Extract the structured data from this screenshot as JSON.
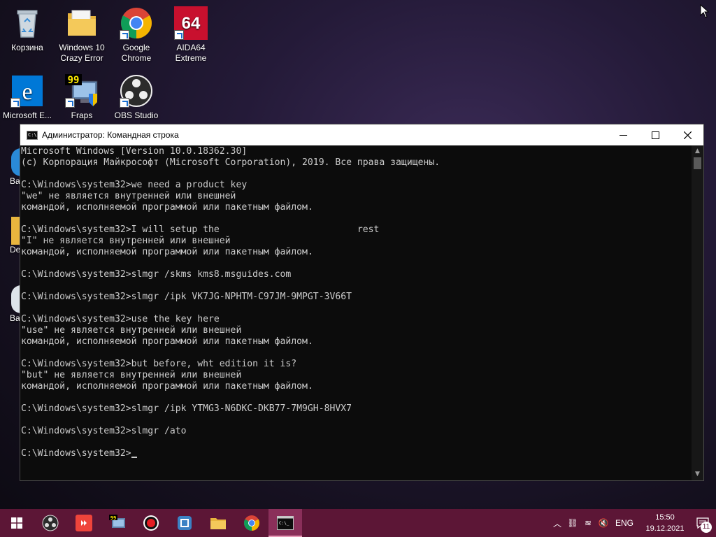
{
  "desktop": {
    "icons": [
      {
        "label": "Корзина",
        "icon": "recycle-bin-icon"
      },
      {
        "label": "Windows 10 Crazy Error",
        "icon": "folder-icon"
      },
      {
        "label": "Google Chrome",
        "icon": "chrome-icon"
      },
      {
        "label": "AIDA64 Extreme",
        "icon": "aida64-icon",
        "badge": "64"
      },
      {
        "label": "Microsoft E...",
        "icon": "edge-icon"
      },
      {
        "label": "Fraps",
        "icon": "fraps-icon",
        "badge": "99"
      },
      {
        "label": "OBS Studio",
        "icon": "obs-icon"
      }
    ],
    "partial_labels": [
      "Ba",
      "De",
      "Ba"
    ]
  },
  "cmd": {
    "title": "Администратор: Командная строка",
    "lines": [
      "Microsoft Windows [Version 10.0.18362.30]",
      "(c) Корпорация Майкрософт (Microsoft Corporation), 2019. Все права защищены.",
      "",
      "C:\\Windows\\system32>we need a product key",
      "\"we\" не является внутренней или внешней",
      "командой, исполняемой программой или пакетным файлом.",
      "",
      "C:\\Windows\\system32>I will setup the                         rest",
      "\"I\" не является внутренней или внешней",
      "командой, исполняемой программой или пакетным файлом.",
      "",
      "C:\\Windows\\system32>slmgr /skms kms8.msguides.com",
      "",
      "C:\\Windows\\system32>slmgr /ipk VK7JG-NPHTM-C97JM-9MPGT-3V66T",
      "",
      "C:\\Windows\\system32>use the key here",
      "\"use\" не является внутренней или внешней",
      "командой, исполняемой программой или пакетным файлом.",
      "",
      "C:\\Windows\\system32>but before, wht edition it is?",
      "\"but\" не является внутренней или внешней",
      "командой, исполняемой программой или пакетным файлом.",
      "",
      "C:\\Windows\\system32>slmgr /ipk YTMG3-N6DKC-DKB77-7M9GH-8HVX7",
      "",
      "C:\\Windows\\system32>slmgr /ato",
      "",
      "C:\\Windows\\system32>"
    ]
  },
  "taskbar": {
    "apps": [
      "start-icon",
      "obs-icon",
      "anydesk-icon",
      "fraps-icon",
      "record-icon",
      "media-icon",
      "explorer-icon",
      "chrome-icon",
      "cmd-icon"
    ],
    "fraps_badge": "99",
    "cmd_glyph": "C:\\_",
    "language": "ENG",
    "time": "15:50",
    "date": "19.12.2021",
    "notifications": "11"
  }
}
